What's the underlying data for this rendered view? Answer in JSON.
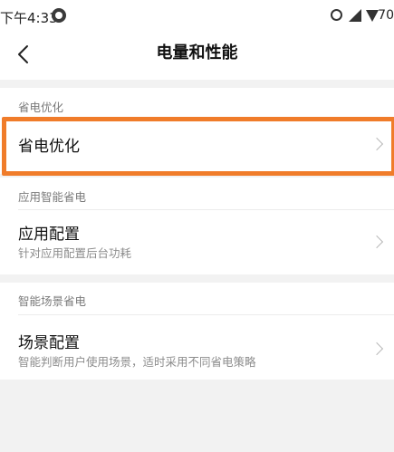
{
  "status_bar": {
    "time": "下午4:33",
    "app_icon": "circle-app-icon",
    "alarm_icon": "alarm-icon",
    "signal_icon": "cell-signal-icon",
    "wifi_icon": "wifi-icon",
    "battery_text": "70"
  },
  "header": {
    "back_icon": "chevron-left-icon",
    "title": "电量和性能"
  },
  "sections": [
    {
      "label": "省电优化",
      "items": [
        {
          "title": "省电优化",
          "subtitle": ""
        }
      ]
    },
    {
      "label": "应用智能省电",
      "items": [
        {
          "title": "应用配置",
          "subtitle": "针对应用配置后台功耗"
        }
      ]
    },
    {
      "label": "智能场景省电",
      "items": [
        {
          "title": "场景配置",
          "subtitle": "智能判断用户使用场景，适时采用不同省电策略"
        }
      ]
    }
  ],
  "colors": {
    "background": "#f2f2f2",
    "card": "#ffffff",
    "highlight": "#f07c2a",
    "section_label": "#7a7a7a",
    "subtitle": "#8c8c8c"
  }
}
